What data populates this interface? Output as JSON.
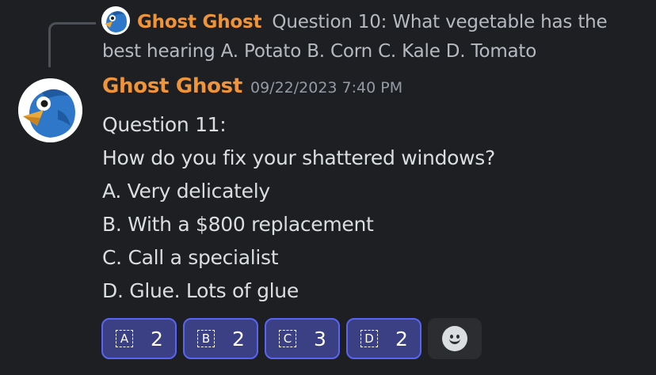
{
  "reply": {
    "author": "Ghost Ghost",
    "text": "Question 10:  What vegetable has the best hearing A. Potato B. Corn C. Kale D. Tomato"
  },
  "message": {
    "author": "Ghost Ghost",
    "timestamp": "09/22/2023 7:40 PM",
    "lines": [
      "Question 11:",
      "How do you fix your shattered windows?",
      "A. Very delicately",
      "B. With a $800 replacement",
      "C. Call a specialist",
      "D. Glue. Lots of glue"
    ]
  },
  "reactions": [
    {
      "emoji": "A",
      "count": "2"
    },
    {
      "emoji": "B",
      "count": "2"
    },
    {
      "emoji": "C",
      "count": "3"
    },
    {
      "emoji": "D",
      "count": "2"
    }
  ],
  "add_reaction_icon": "add-reaction-smiley-icon",
  "colors": {
    "background": "#1e1f22",
    "author": "#f0943a",
    "reaction_border": "#5865f2",
    "reaction_fill": "#3b3f83"
  }
}
